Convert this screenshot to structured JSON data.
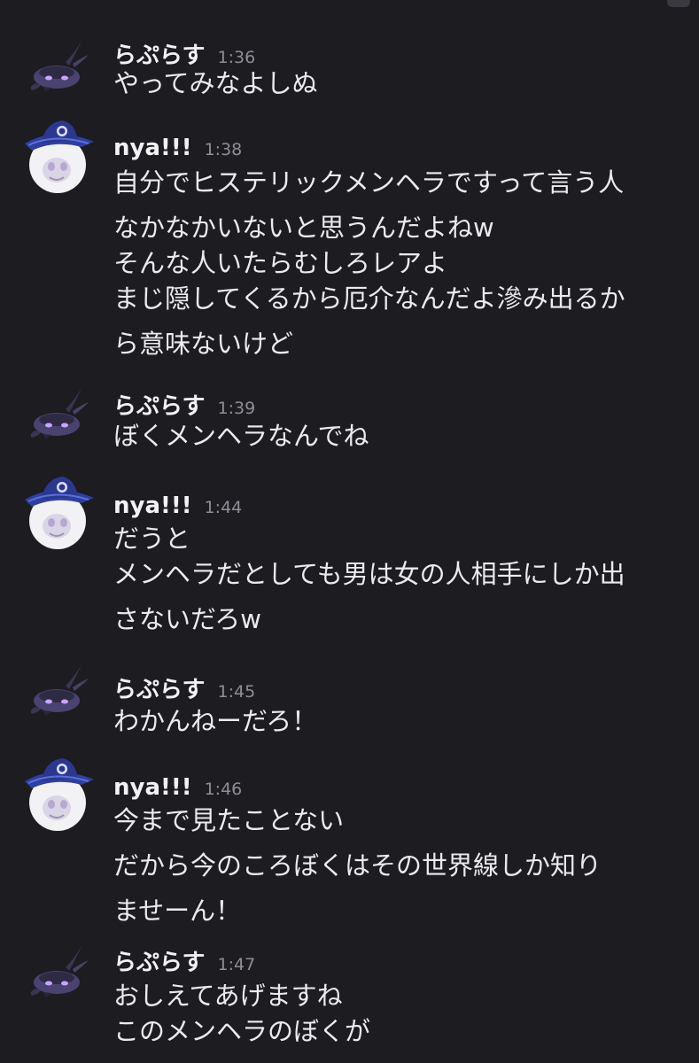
{
  "messages": [
    {
      "author": "らぷらす",
      "time": "1:36",
      "avatar": "creature-avatar",
      "lines": [
        "やってみなよしぬ"
      ]
    },
    {
      "author": "nya!!!",
      "time": "1:38",
      "avatar": "witch-cat-avatar",
      "lines": [
        "自分でヒステリックメンヘラですって言う人",
        "なかなかいないと思うんだよねw",
        "そんな人いたらむしろレアよ",
        "まじ隠してくるから厄介なんだよ滲み出るか",
        "ら意味ないけど"
      ]
    },
    {
      "author": "らぷらす",
      "time": "1:39",
      "avatar": "creature-avatar",
      "lines": [
        "ぼくメンヘラなんでね"
      ]
    },
    {
      "author": "nya!!!",
      "time": "1:44",
      "avatar": "witch-cat-avatar",
      "lines": [
        "だうと",
        "メンヘラだとしても男は女の人相手にしか出",
        "さないだろw"
      ]
    },
    {
      "author": "らぷらす",
      "time": "1:45",
      "avatar": "creature-avatar",
      "lines": [
        "わかんねーだろ！"
      ]
    },
    {
      "author": "nya!!!",
      "time": "1:46",
      "avatar": "witch-cat-avatar",
      "lines": [
        "今まで見たことない",
        "だから今のころぼくはその世界線しか知り",
        "ませーん！"
      ]
    },
    {
      "author": "らぷらす",
      "time": "1:47",
      "avatar": "creature-avatar",
      "lines": [
        "おしえてあげますね",
        "このメンヘラのぼくが"
      ]
    }
  ]
}
